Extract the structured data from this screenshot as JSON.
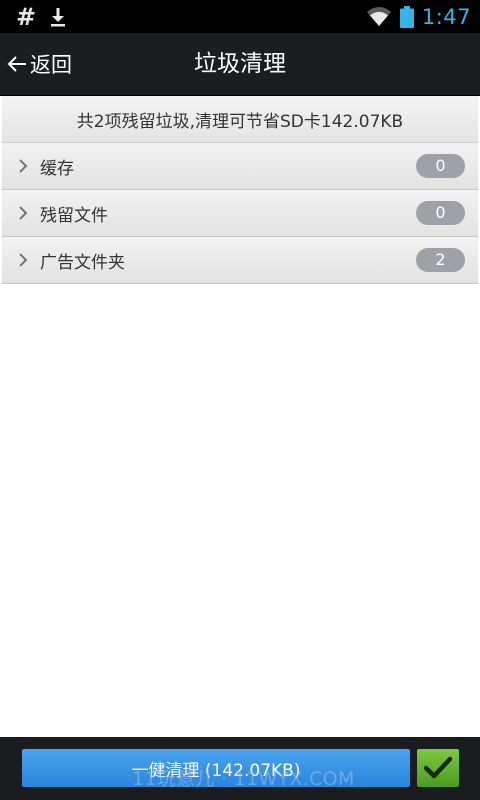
{
  "status_bar": {
    "time": "1:47",
    "left_icons": [
      "hash-icon",
      "download-icon"
    ],
    "right_icons": [
      "wifi-icon",
      "battery-icon"
    ]
  },
  "title_bar": {
    "back_label": "返回",
    "title": "垃圾清理"
  },
  "summary": {
    "text": "共2项残留垃圾,清理可节省SD卡142.07KB"
  },
  "categories": [
    {
      "label": "缓存",
      "count": "0"
    },
    {
      "label": "残留文件",
      "count": "0"
    },
    {
      "label": "广告文件夹",
      "count": "2"
    }
  ],
  "bottom_bar": {
    "clean_label": "一健清理 (142.07KB)",
    "confirm_icon": "checkmark-icon"
  },
  "watermark": {
    "text": "11玩意儿 · 11WYX.COM"
  },
  "colors": {
    "status_bar_bg": "#000000",
    "clock": "#33b5e5",
    "title_bar_bg": "#1c1d21",
    "button_blue": "#2a86dd",
    "button_green": "#4a9b21",
    "badge_gray": "#9ea1a6"
  }
}
